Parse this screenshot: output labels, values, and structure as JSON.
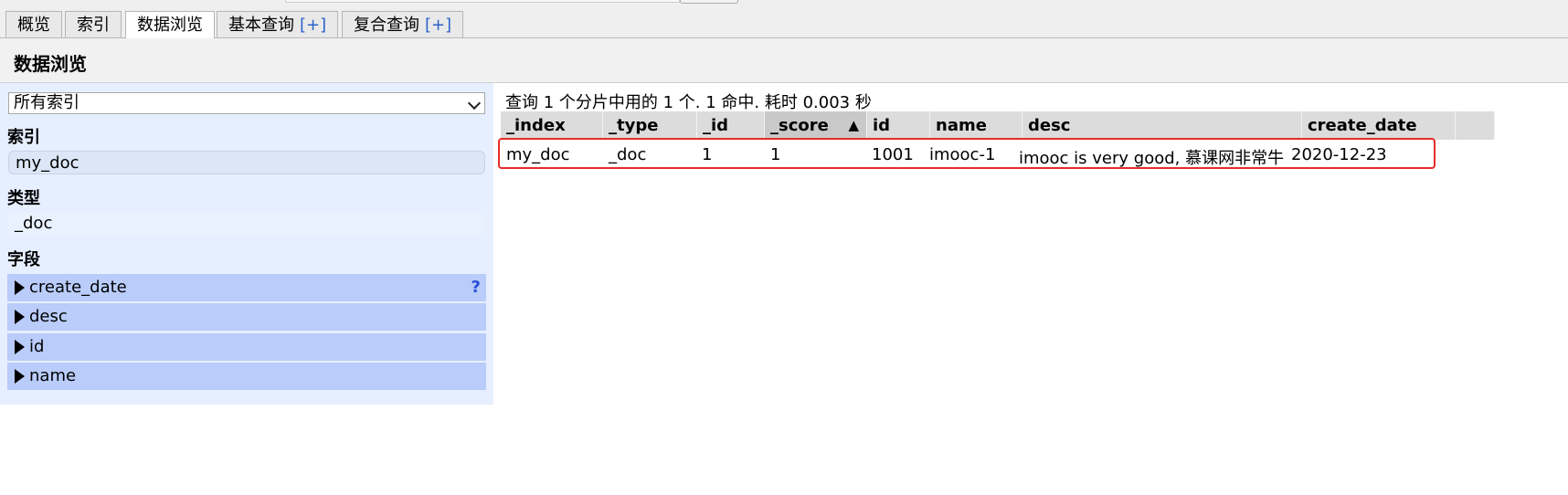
{
  "tabs": [
    {
      "label": "概览",
      "plus": ""
    },
    {
      "label": "索引",
      "plus": ""
    },
    {
      "label": "数据浏览",
      "plus": ""
    },
    {
      "label": "基本查询",
      "plus": "[+]"
    },
    {
      "label": "复合查询",
      "plus": "[+]"
    }
  ],
  "header": {
    "title": "数据浏览"
  },
  "sidebar": {
    "select_value": "所有索引",
    "index_title": "索引",
    "index_value": "my_doc",
    "type_title": "类型",
    "type_value": "_doc",
    "fields_title": "字段",
    "fields": [
      "create_date",
      "desc",
      "id",
      "name"
    ],
    "help": "?"
  },
  "results": {
    "summary": "查询 1 个分片中用的 1 个. 1 命中. 耗时 0.003 秒",
    "columns": [
      "_index",
      "_type",
      "_id",
      "_score",
      "id",
      "name",
      "desc",
      "create_date"
    ],
    "sort_arrow": "▲",
    "rows": [
      [
        "my_doc",
        "_doc",
        "1",
        "1",
        "1001",
        "imooc-1",
        "imooc is very good, 慕课网非常牛",
        "2020-12-23"
      ]
    ]
  },
  "colors": {
    "highlight_border": "#e82b2b",
    "field_bg": "#b9ccfa",
    "sidebar_bg": "#e6efff"
  }
}
